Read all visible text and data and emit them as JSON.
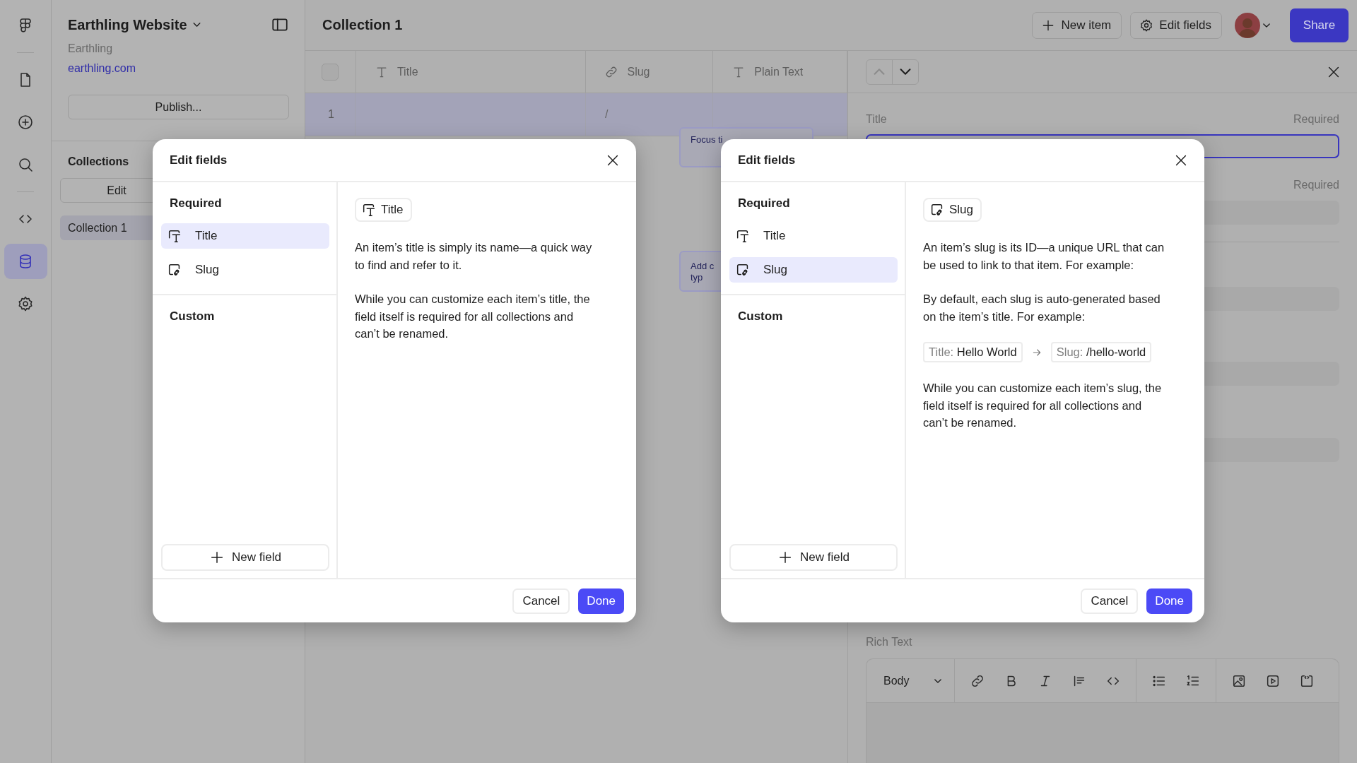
{
  "rail": {
    "items": [
      {
        "kind": "logo"
      },
      {
        "kind": "pages",
        "selected": false
      },
      {
        "kind": "insert",
        "selected": false
      },
      {
        "kind": "search",
        "selected": false
      },
      {
        "kind": "code",
        "selected": false
      },
      {
        "kind": "cms",
        "selected": true
      },
      {
        "kind": "settings",
        "selected": false
      }
    ]
  },
  "project": {
    "name": "Earthling Website",
    "team": "Earthling",
    "domain": "earthling.com",
    "publish_button": "Publish..."
  },
  "collections": {
    "heading": "Collections",
    "edit_button": "Edit",
    "items": [
      {
        "label": "Collection 1",
        "selected": true
      }
    ]
  },
  "toolbar": {
    "title": "Collection 1",
    "new_item_button": "New item",
    "edit_fields_button": "Edit fields",
    "share_button": "Share"
  },
  "table": {
    "select_all_checked": false,
    "columns": [
      {
        "label": "Title",
        "kind": "text"
      },
      {
        "label": "Slug",
        "kind": "link"
      },
      {
        "label": "Plain Text",
        "kind": "text"
      }
    ],
    "rows": [
      {
        "index": "1",
        "selected": true,
        "slug": "/"
      }
    ]
  },
  "tooltips": [
    {
      "lines": [
        "Focus ti"
      ]
    },
    {
      "lines": [
        "Add c",
        "typ"
      ]
    }
  ],
  "detail": {
    "previous_disabled": true,
    "next_disabled": false,
    "title_label": "Title",
    "title_required": "Required",
    "second_required": "Required",
    "rich_text_label": "Rich Text",
    "format_select": "Body"
  },
  "dialogs": [
    {
      "title": "Edit fields",
      "sections": [
        {
          "heading": "Required",
          "fields": [
            {
              "label": "Title",
              "kind": "title",
              "selected": true
            },
            {
              "label": "Slug",
              "kind": "slug",
              "selected": false
            }
          ]
        },
        {
          "heading": "Custom"
        }
      ],
      "new_field_button": "New field",
      "chip": {
        "label": "Title",
        "kind": "title"
      },
      "blocks": [
        {
          "kind": "paragraph",
          "text": "An item’s title is simply its name—a quick way to find and refer to it."
        },
        {
          "kind": "paragraph",
          "text": "While you can customize each item’s title, the field itself is required for all collections and can’t be renamed."
        }
      ],
      "cancel_button": "Cancel",
      "done_button": "Done"
    },
    {
      "title": "Edit fields",
      "sections": [
        {
          "heading": "Required",
          "fields": [
            {
              "label": "Title",
              "kind": "title",
              "selected": false
            },
            {
              "label": "Slug",
              "kind": "slug",
              "selected": true
            }
          ]
        },
        {
          "heading": "Custom"
        }
      ],
      "new_field_button": "New field",
      "chip": {
        "label": "Slug",
        "kind": "slug"
      },
      "blocks": [
        {
          "kind": "paragraph",
          "text": "An item’s slug is its ID—a unique URL that can be used to link to that item. For example:"
        },
        {
          "kind": "paragraph",
          "text": "By default, each slug is auto-generated based on the item’s title. For example:"
        },
        {
          "kind": "example",
          "from_label": "Title:",
          "from_value": "Hello World",
          "to_label": "Slug:",
          "to_value": "/hello-world"
        },
        {
          "kind": "paragraph",
          "text": "While you can customize each item’s slug, the field itself is required for all collections and can’t be renamed."
        }
      ],
      "cancel_button": "Cancel",
      "done_button": "Done"
    }
  ]
}
